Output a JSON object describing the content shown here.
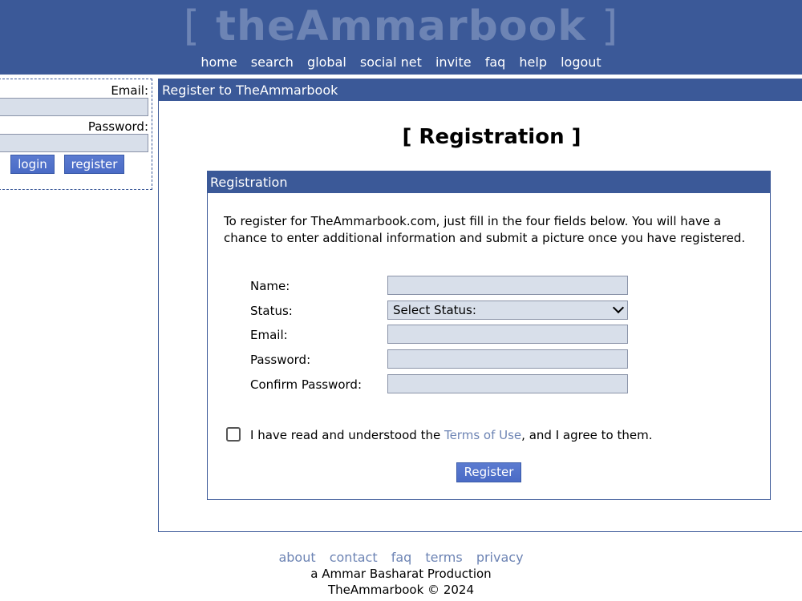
{
  "header": {
    "logo": "theAmmarbook",
    "logo_open": "[",
    "logo_close": "]",
    "nav": [
      "home",
      "search",
      "global",
      "social net",
      "invite",
      "faq",
      "help",
      "logout"
    ]
  },
  "login": {
    "email_label": "Email:",
    "password_label": "Password:",
    "login_button": "login",
    "register_button": "register"
  },
  "main": {
    "title": "Register to TheAmmarbook",
    "heading": "[ Registration ]",
    "box_title": "Registration",
    "intro": "To register for TheAmmarbook.com, just fill in the four fields below. You will have a chance to enter additional information and submit a picture once you have registered.",
    "fields": {
      "name": "Name:",
      "status": "Status:",
      "email": "Email:",
      "password": "Password:",
      "confirm": "Confirm Password:"
    },
    "status_value": "Select Status:",
    "agree_pre": "I have read and understood the ",
    "agree_link": "Terms of Use",
    "agree_post": ", and I agree to them.",
    "submit": "Register"
  },
  "footer": {
    "links": [
      "about",
      "contact",
      "faq",
      "terms",
      "privacy"
    ],
    "credit": "a Ammar Basharat Production",
    "copyright": "TheAmmarbook © 2024"
  },
  "colors": {
    "brand": "#3b5998",
    "logo": "#6d84b4",
    "input_bg": "#d8dfea",
    "link": "#6d84b4"
  }
}
